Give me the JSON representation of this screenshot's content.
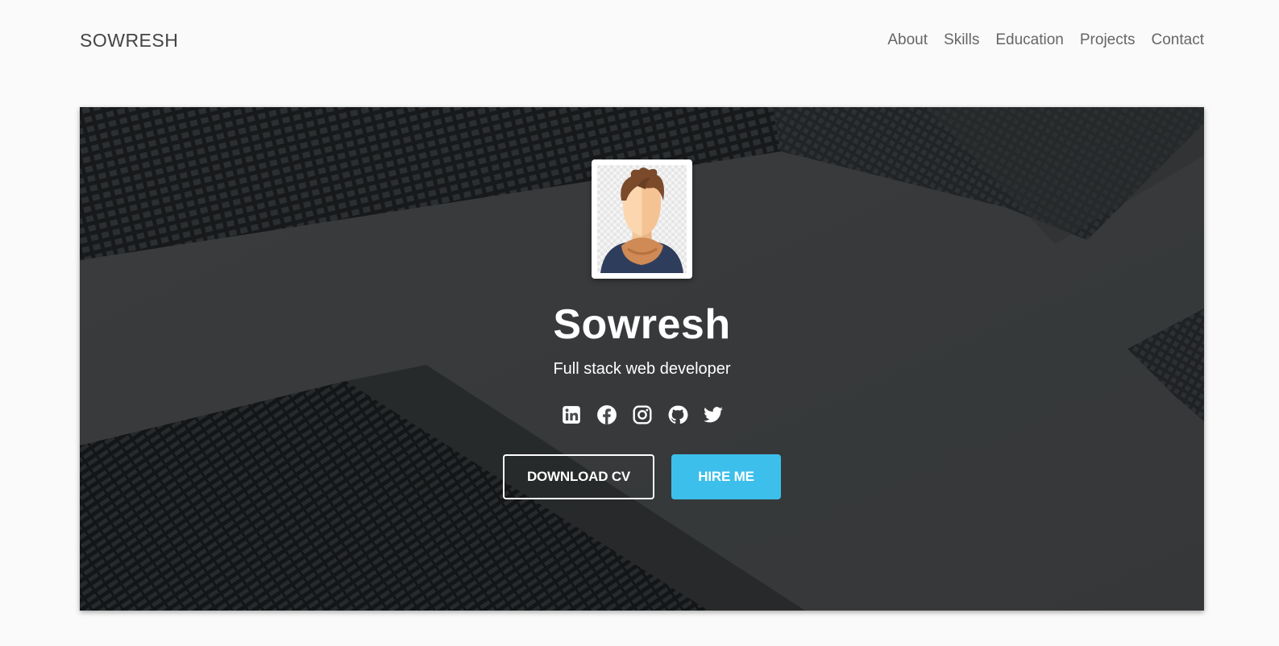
{
  "nav": {
    "brand": "SOWRESH",
    "links": [
      "About",
      "Skills",
      "Education",
      "Projects",
      "Contact"
    ]
  },
  "hero": {
    "name": "Sowresh",
    "subtitle": "Full stack web developer",
    "socials": [
      "linkedin-icon",
      "facebook-icon",
      "instagram-icon",
      "github-icon",
      "twitter-icon"
    ],
    "download_label": "DOWNLOAD CV",
    "hire_label": "HIRE ME"
  },
  "colors": {
    "accent": "#3dbfeb",
    "page_bg": "#fafafa",
    "hero_overlay": "#484a4c"
  }
}
